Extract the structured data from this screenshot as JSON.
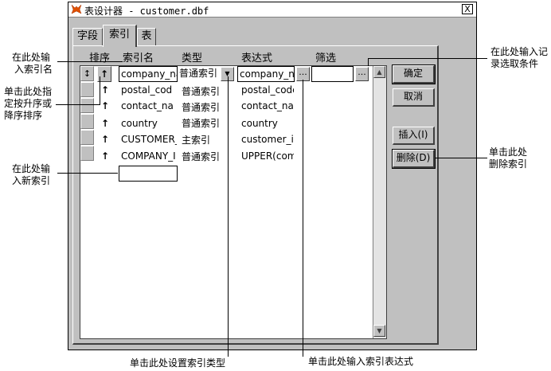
{
  "window": {
    "title": "表设计器 - customer.dbf",
    "close_label": "X"
  },
  "tabs": [
    {
      "label": "字段"
    },
    {
      "label": "索引"
    },
    {
      "label": "表"
    }
  ],
  "columns": {
    "sort": "排序",
    "name": "索引名",
    "type": "类型",
    "expr": "表达式",
    "filter": "筛选"
  },
  "rows": [
    {
      "sort": "↑",
      "name": "company_na",
      "type": "普通索引",
      "expr": "company_na"
    },
    {
      "sort": "↑",
      "name": "postal_cod",
      "type": "普通索引",
      "expr": "postal_code"
    },
    {
      "sort": "↑",
      "name": "contact_na",
      "type": "普通索引",
      "expr": "contact_nan"
    },
    {
      "sort": "↑",
      "name": "country",
      "type": "普通索引",
      "expr": "country"
    },
    {
      "sort": "↑",
      "name": "CUSTOMER_",
      "type": "主索引",
      "expr": "customer_ic"
    },
    {
      "sort": "↑",
      "name": "COMPANY_I",
      "type": "普通索引",
      "expr": "UPPER(com"
    }
  ],
  "move_glyph": "↕",
  "ellipsis": "...",
  "buttons": {
    "ok": "确定",
    "cancel": "取消",
    "insert": "插入(I)",
    "delete": "删除(D)"
  },
  "callouts": {
    "name_1": "在此处输",
    "name_2": "入索引名",
    "order_1": "单击此处指",
    "order_2": "定按升序或",
    "order_3": "降序排序",
    "new_1": "在此处输",
    "new_2": "入新索引",
    "filter_1": "在此处输入记",
    "filter_2": "录选取条件",
    "delete_1": "单击此处",
    "delete_2": "删除索引",
    "type": "单击此处设置索引类型",
    "expr": "单击此处输入索引表达式"
  }
}
